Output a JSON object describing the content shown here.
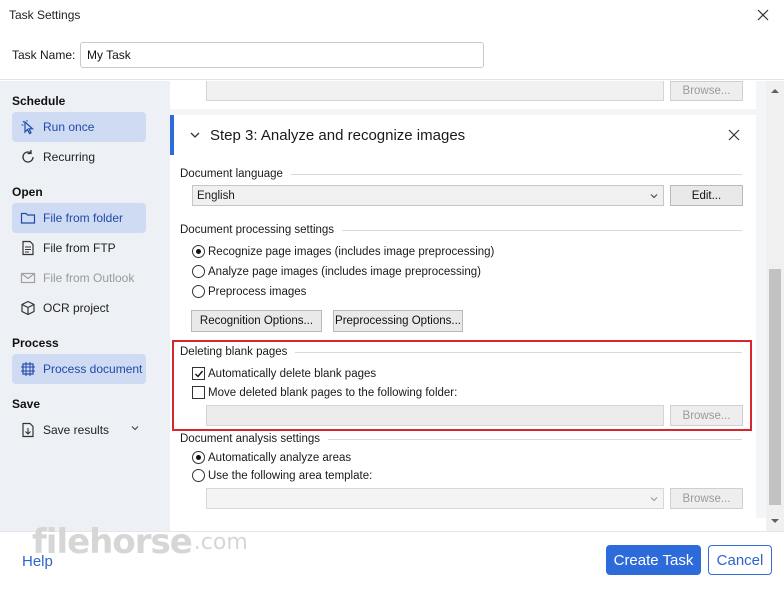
{
  "window": {
    "title": "Task Settings"
  },
  "task_name": {
    "label": "Task Name:",
    "value": "My Task"
  },
  "sidebar": {
    "schedule": {
      "heading": "Schedule",
      "items": [
        {
          "label": "Run once",
          "icon": "cursor-click-icon",
          "selected": true
        },
        {
          "label": "Recurring",
          "icon": "refresh-icon",
          "selected": false
        }
      ]
    },
    "open": {
      "heading": "Open",
      "items": [
        {
          "label": "File from folder",
          "icon": "folder-icon",
          "selected": true
        },
        {
          "label": "File from FTP",
          "icon": "document-icon",
          "selected": false
        },
        {
          "label": "File from Outlook",
          "icon": "mail-icon",
          "disabled": true
        },
        {
          "label": "OCR project",
          "icon": "cube-icon",
          "selected": false
        }
      ]
    },
    "process": {
      "heading": "Process",
      "items": [
        {
          "label": "Process document",
          "icon": "scan-icon",
          "selected": true
        }
      ]
    },
    "save": {
      "heading": "Save",
      "items": [
        {
          "label": "Save results",
          "icon": "save-document-icon",
          "selected": false
        }
      ]
    }
  },
  "previous_card": {
    "browse_label": "Browse..."
  },
  "step3": {
    "title": "Step 3: Analyze and recognize images",
    "document_language": {
      "heading": "Document language",
      "selected": "English",
      "edit_label": "Edit..."
    },
    "processing": {
      "heading": "Document processing settings",
      "options": [
        "Recognize page images (includes image preprocessing)",
        "Analyze page images (includes image preprocessing)",
        "Preprocess images"
      ],
      "selected_index": 0,
      "recognition_options_label": "Recognition Options...",
      "preprocessing_options_label": "Preprocessing Options..."
    },
    "blank_pages": {
      "heading": "Deleting blank pages",
      "auto_delete_label": "Automatically delete blank pages",
      "auto_delete_checked": true,
      "move_label": "Move deleted blank pages to the following folder:",
      "move_checked": false,
      "browse_label": "Browse..."
    },
    "analysis": {
      "heading": "Document analysis settings",
      "options": [
        "Automatically analyze areas",
        "Use the following area template:"
      ],
      "selected_index": 0,
      "browse_label": "Browse..."
    }
  },
  "footer": {
    "help_label": "Help",
    "create_label": "Create Task",
    "cancel_label": "Cancel"
  },
  "watermark": {
    "brand": "filehorse",
    "domain": ".com"
  },
  "colors": {
    "accent": "#2d6bdb",
    "highlight": "#d7262c",
    "sidebar_bg": "#edf0f4",
    "selected_bg": "#cfdbf3"
  }
}
